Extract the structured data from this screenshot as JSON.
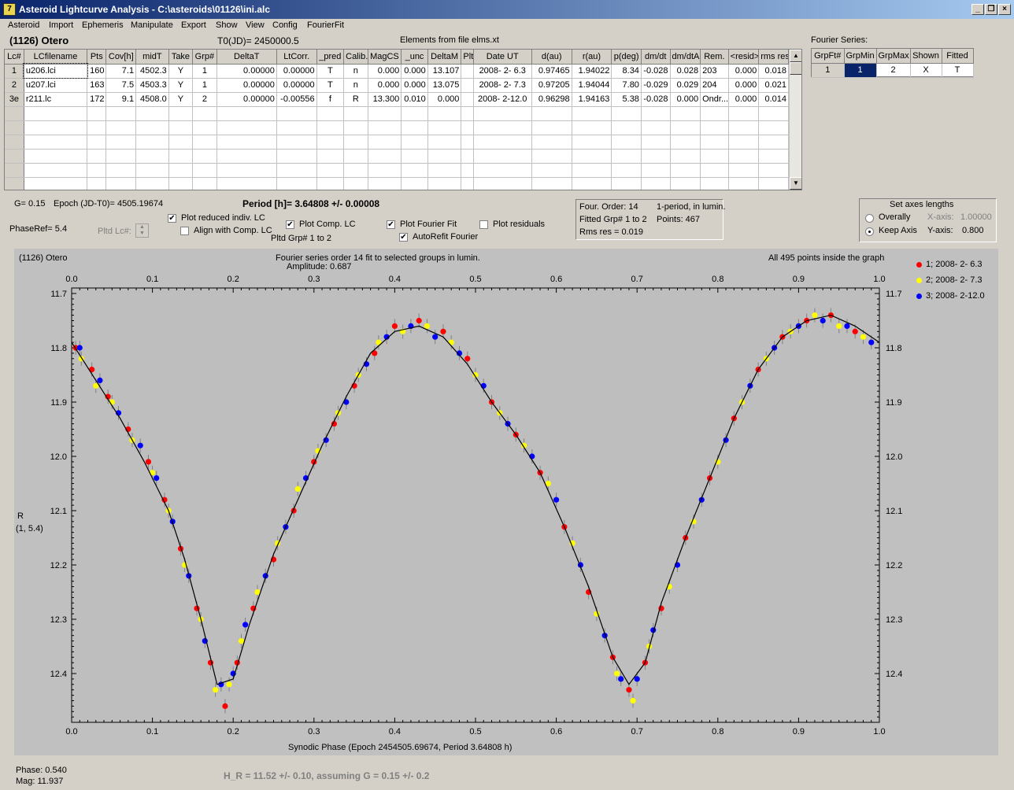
{
  "window": {
    "title": "Asteroid Lightcurve Analysis - C:\\asteroids\\01126\\ini.alc",
    "icon": "app-icon"
  },
  "menu": [
    "Asteroid",
    "Import",
    "Ephemeris",
    "Manipulate",
    "Export",
    "Show",
    "View",
    "Config",
    "FourierFit"
  ],
  "header": {
    "asteroid": "(1126) Otero",
    "t0": "T0(JD)= 2450000.5",
    "elements": "Elements from file elms.xt",
    "fourier_series_label": "Fourier Series:"
  },
  "lc_table": {
    "columns": [
      "Lc#",
      "LCfilename",
      "Pts",
      "Cov[h]",
      "midT",
      "Take",
      "Grp#",
      "DeltaT",
      "LtCorr.",
      "_pred",
      "Calib.",
      "MagCS",
      "_unc",
      "DeltaM",
      "Plt",
      "Date UT",
      "d(au)",
      "r(au)",
      "p(deg)",
      "dm/dt",
      "dm/dtA",
      "Rem.",
      "<resid>",
      "rms res"
    ],
    "rows": [
      [
        "1",
        "u206.lci",
        "160",
        "7.1",
        "4502.3",
        "Y",
        "1",
        "0.00000",
        "0.00000",
        "T",
        "n",
        "0.000",
        "0.000",
        "13.107",
        "",
        "2008- 2- 6.3",
        "0.97465",
        "1.94022",
        "8.34",
        "-0.028",
        "0.028",
        "203",
        "0.000",
        "0.018"
      ],
      [
        "2",
        "u207.lci",
        "163",
        "7.5",
        "4503.3",
        "Y",
        "1",
        "0.00000",
        "0.00000",
        "T",
        "n",
        "0.000",
        "0.000",
        "13.075",
        "",
        "2008- 2- 7.3",
        "0.97205",
        "1.94044",
        "7.80",
        "-0.029",
        "0.029",
        "204",
        "0.000",
        "0.021"
      ],
      [
        "3e",
        "r211.lc",
        "172",
        "9.1",
        "4508.0",
        "Y",
        "2",
        "0.00000",
        "-0.00556",
        "f",
        "R",
        "13.300",
        "0.010",
        "0.000",
        "",
        "2008- 2-12.0",
        "0.96298",
        "1.94163",
        "5.38",
        "-0.028",
        "0.000",
        "Ondr...",
        "0.000",
        "0.014"
      ]
    ],
    "empty_rows": 6
  },
  "fourier_table": {
    "columns": [
      "GrpFt#",
      "GrpMin",
      "GrpMax",
      "Shown",
      "Fitted"
    ],
    "row": [
      "1",
      "1",
      "2",
      "X",
      "T"
    ]
  },
  "controls": {
    "g_line": "G= 0.15",
    "epoch": "Epoch (JD-T0)= 4505.19674",
    "period": "Period [h]= 3.64808 +/- 0.00008",
    "phaseref": "PhaseRef= 5.4",
    "pltd_lc": "Pltd Lc#:",
    "plot_reduced": "Plot reduced indiv. LC",
    "align_comp": "Align with Comp. LC",
    "plot_comp": "Plot Comp. LC",
    "pltd_grp": "Pltd Grp#  1   to   2",
    "plot_fourier": "Plot Fourier Fit",
    "autorefit": "AutoRefit Fourier",
    "plot_residuals": "Plot residuals",
    "checks": {
      "plot_reduced": true,
      "align_comp": false,
      "plot_comp": true,
      "plot_fourier": true,
      "autorefit": true,
      "plot_residuals": false
    }
  },
  "fit_info": {
    "order": "Four. Order: 14",
    "period_mode": "1-period, in lumin.",
    "fitted": "Fitted Grp# 1 to 2",
    "points": "Points: 467",
    "rms": "Rms res     = 0.019"
  },
  "axes_box": {
    "title": "Set axes lengths",
    "overally": "Overally",
    "keep": "Keep Axis",
    "xaxis_label": "X-axis:",
    "xaxis_val": "1.00000",
    "yaxis_label": "Y-axis:",
    "yaxis_val": "0.800",
    "selected": "Keep Axis"
  },
  "plot": {
    "top_left": "(1126) Otero",
    "top_center": "Fourier series order 14 fit to selected groups in lumin.",
    "amplitude": "Amplitude: 0.687",
    "top_right": "All 495 points inside the graph",
    "ylabel1": "R",
    "ylabel2": "(1, 5.4)",
    "xlabel": "Synodic Phase (Epoch 2454505.69674, Period 3.64808 h)",
    "background": "#c0c0c0"
  },
  "chart_data": {
    "type": "scatter",
    "xlabel": "Synodic Phase (Epoch 2454505.69674, Period 3.64808 h)",
    "ylabel": "R",
    "xlim": [
      0,
      1
    ],
    "ylim": [
      11.69,
      12.49
    ],
    "y_inverted": true,
    "x_ticks": [
      "0.0",
      "0.1",
      "0.2",
      "0.3",
      "0.4",
      "0.5",
      "0.6",
      "0.7",
      "0.8",
      "0.9",
      "1.0"
    ],
    "y_ticks": [
      "11.7",
      "11.8",
      "11.9",
      "12.0",
      "12.1",
      "12.2",
      "12.3",
      "12.4"
    ],
    "legend_position": "top-right",
    "series": [
      {
        "name": "1; 2008- 2- 6.3",
        "color": "#ff0000"
      },
      {
        "name": "2; 2008- 2- 7.3",
        "color": "#ffff00"
      },
      {
        "name": "3; 2008- 2-12.0",
        "color": "#0000ff"
      }
    ],
    "fit_curve": [
      [
        0.0,
        11.79
      ],
      [
        0.03,
        11.86
      ],
      [
        0.06,
        11.93
      ],
      [
        0.09,
        12.01
      ],
      [
        0.12,
        12.1
      ],
      [
        0.14,
        12.19
      ],
      [
        0.16,
        12.3
      ],
      [
        0.18,
        12.42
      ],
      [
        0.2,
        12.41
      ],
      [
        0.22,
        12.31
      ],
      [
        0.25,
        12.18
      ],
      [
        0.28,
        12.08
      ],
      [
        0.31,
        11.98
      ],
      [
        0.34,
        11.89
      ],
      [
        0.37,
        11.81
      ],
      [
        0.4,
        11.77
      ],
      [
        0.43,
        11.76
      ],
      [
        0.46,
        11.78
      ],
      [
        0.49,
        11.83
      ],
      [
        0.52,
        11.9
      ],
      [
        0.55,
        11.96
      ],
      [
        0.58,
        12.03
      ],
      [
        0.61,
        12.13
      ],
      [
        0.64,
        12.24
      ],
      [
        0.67,
        12.37
      ],
      [
        0.69,
        12.42
      ],
      [
        0.71,
        12.38
      ],
      [
        0.73,
        12.27
      ],
      [
        0.76,
        12.15
      ],
      [
        0.79,
        12.04
      ],
      [
        0.82,
        11.93
      ],
      [
        0.85,
        11.84
      ],
      [
        0.88,
        11.78
      ],
      [
        0.91,
        11.75
      ],
      [
        0.94,
        11.74
      ],
      [
        0.97,
        11.76
      ],
      [
        1.0,
        11.79
      ]
    ],
    "points": [
      {
        "s": 0,
        "x": 0.005,
        "y": 11.8
      },
      {
        "s": 1,
        "x": 0.012,
        "y": 11.82
      },
      {
        "s": 2,
        "x": 0.01,
        "y": 11.8
      },
      {
        "s": 0,
        "x": 0.025,
        "y": 11.84
      },
      {
        "s": 1,
        "x": 0.03,
        "y": 11.87
      },
      {
        "s": 2,
        "x": 0.035,
        "y": 11.86
      },
      {
        "s": 0,
        "x": 0.045,
        "y": 11.89
      },
      {
        "s": 1,
        "x": 0.05,
        "y": 11.9
      },
      {
        "s": 2,
        "x": 0.058,
        "y": 11.92
      },
      {
        "s": 0,
        "x": 0.07,
        "y": 11.95
      },
      {
        "s": 1,
        "x": 0.075,
        "y": 11.97
      },
      {
        "s": 2,
        "x": 0.085,
        "y": 11.98
      },
      {
        "s": 0,
        "x": 0.095,
        "y": 12.01
      },
      {
        "s": 1,
        "x": 0.1,
        "y": 12.03
      },
      {
        "s": 2,
        "x": 0.105,
        "y": 12.04
      },
      {
        "s": 0,
        "x": 0.115,
        "y": 12.08
      },
      {
        "s": 1,
        "x": 0.12,
        "y": 12.1
      },
      {
        "s": 2,
        "x": 0.125,
        "y": 12.12
      },
      {
        "s": 0,
        "x": 0.135,
        "y": 12.17
      },
      {
        "s": 1,
        "x": 0.14,
        "y": 12.2
      },
      {
        "s": 2,
        "x": 0.145,
        "y": 12.22
      },
      {
        "s": 0,
        "x": 0.155,
        "y": 12.28
      },
      {
        "s": 1,
        "x": 0.16,
        "y": 12.3
      },
      {
        "s": 2,
        "x": 0.165,
        "y": 12.34
      },
      {
        "s": 0,
        "x": 0.172,
        "y": 12.38
      },
      {
        "s": 1,
        "x": 0.178,
        "y": 12.43
      },
      {
        "s": 2,
        "x": 0.185,
        "y": 12.42
      },
      {
        "s": 0,
        "x": 0.19,
        "y": 12.46
      },
      {
        "s": 1,
        "x": 0.195,
        "y": 12.42
      },
      {
        "s": 2,
        "x": 0.2,
        "y": 12.4
      },
      {
        "s": 0,
        "x": 0.205,
        "y": 12.38
      },
      {
        "s": 1,
        "x": 0.21,
        "y": 12.34
      },
      {
        "s": 2,
        "x": 0.215,
        "y": 12.31
      },
      {
        "s": 0,
        "x": 0.225,
        "y": 12.28
      },
      {
        "s": 1,
        "x": 0.23,
        "y": 12.25
      },
      {
        "s": 2,
        "x": 0.24,
        "y": 12.22
      },
      {
        "s": 0,
        "x": 0.25,
        "y": 12.19
      },
      {
        "s": 1,
        "x": 0.255,
        "y": 12.16
      },
      {
        "s": 2,
        "x": 0.265,
        "y": 12.13
      },
      {
        "s": 0,
        "x": 0.275,
        "y": 12.1
      },
      {
        "s": 1,
        "x": 0.28,
        "y": 12.06
      },
      {
        "s": 2,
        "x": 0.29,
        "y": 12.04
      },
      {
        "s": 0,
        "x": 0.3,
        "y": 12.01
      },
      {
        "s": 1,
        "x": 0.305,
        "y": 11.99
      },
      {
        "s": 2,
        "x": 0.315,
        "y": 11.97
      },
      {
        "s": 0,
        "x": 0.325,
        "y": 11.94
      },
      {
        "s": 1,
        "x": 0.33,
        "y": 11.92
      },
      {
        "s": 2,
        "x": 0.34,
        "y": 11.9
      },
      {
        "s": 0,
        "x": 0.35,
        "y": 11.87
      },
      {
        "s": 1,
        "x": 0.355,
        "y": 11.85
      },
      {
        "s": 2,
        "x": 0.365,
        "y": 11.83
      },
      {
        "s": 0,
        "x": 0.375,
        "y": 11.81
      },
      {
        "s": 1,
        "x": 0.38,
        "y": 11.79
      },
      {
        "s": 2,
        "x": 0.39,
        "y": 11.78
      },
      {
        "s": 0,
        "x": 0.4,
        "y": 11.76
      },
      {
        "s": 1,
        "x": 0.41,
        "y": 11.77
      },
      {
        "s": 2,
        "x": 0.42,
        "y": 11.76
      },
      {
        "s": 0,
        "x": 0.43,
        "y": 11.75
      },
      {
        "s": 1,
        "x": 0.44,
        "y": 11.76
      },
      {
        "s": 2,
        "x": 0.45,
        "y": 11.78
      },
      {
        "s": 0,
        "x": 0.46,
        "y": 11.77
      },
      {
        "s": 1,
        "x": 0.47,
        "y": 11.79
      },
      {
        "s": 2,
        "x": 0.48,
        "y": 11.81
      },
      {
        "s": 0,
        "x": 0.49,
        "y": 11.82
      },
      {
        "s": 1,
        "x": 0.5,
        "y": 11.85
      },
      {
        "s": 2,
        "x": 0.51,
        "y": 11.87
      },
      {
        "s": 0,
        "x": 0.52,
        "y": 11.9
      },
      {
        "s": 1,
        "x": 0.53,
        "y": 11.92
      },
      {
        "s": 2,
        "x": 0.54,
        "y": 11.94
      },
      {
        "s": 0,
        "x": 0.55,
        "y": 11.96
      },
      {
        "s": 1,
        "x": 0.56,
        "y": 11.98
      },
      {
        "s": 2,
        "x": 0.57,
        "y": 12.0
      },
      {
        "s": 0,
        "x": 0.58,
        "y": 12.03
      },
      {
        "s": 1,
        "x": 0.59,
        "y": 12.05
      },
      {
        "s": 2,
        "x": 0.6,
        "y": 12.08
      },
      {
        "s": 0,
        "x": 0.61,
        "y": 12.13
      },
      {
        "s": 1,
        "x": 0.62,
        "y": 12.16
      },
      {
        "s": 2,
        "x": 0.63,
        "y": 12.2
      },
      {
        "s": 0,
        "x": 0.64,
        "y": 12.25
      },
      {
        "s": 1,
        "x": 0.65,
        "y": 12.29
      },
      {
        "s": 2,
        "x": 0.66,
        "y": 12.33
      },
      {
        "s": 0,
        "x": 0.67,
        "y": 12.37
      },
      {
        "s": 1,
        "x": 0.675,
        "y": 12.4
      },
      {
        "s": 2,
        "x": 0.68,
        "y": 12.41
      },
      {
        "s": 0,
        "x": 0.69,
        "y": 12.43
      },
      {
        "s": 1,
        "x": 0.695,
        "y": 12.45
      },
      {
        "s": 2,
        "x": 0.7,
        "y": 12.41
      },
      {
        "s": 0,
        "x": 0.71,
        "y": 12.38
      },
      {
        "s": 1,
        "x": 0.715,
        "y": 12.35
      },
      {
        "s": 2,
        "x": 0.72,
        "y": 12.32
      },
      {
        "s": 0,
        "x": 0.73,
        "y": 12.28
      },
      {
        "s": 1,
        "x": 0.74,
        "y": 12.24
      },
      {
        "s": 2,
        "x": 0.75,
        "y": 12.2
      },
      {
        "s": 0,
        "x": 0.76,
        "y": 12.15
      },
      {
        "s": 1,
        "x": 0.77,
        "y": 12.12
      },
      {
        "s": 2,
        "x": 0.78,
        "y": 12.08
      },
      {
        "s": 0,
        "x": 0.79,
        "y": 12.04
      },
      {
        "s": 1,
        "x": 0.8,
        "y": 12.01
      },
      {
        "s": 2,
        "x": 0.81,
        "y": 11.97
      },
      {
        "s": 0,
        "x": 0.82,
        "y": 11.93
      },
      {
        "s": 1,
        "x": 0.83,
        "y": 11.9
      },
      {
        "s": 2,
        "x": 0.84,
        "y": 11.87
      },
      {
        "s": 0,
        "x": 0.85,
        "y": 11.84
      },
      {
        "s": 1,
        "x": 0.86,
        "y": 11.82
      },
      {
        "s": 2,
        "x": 0.87,
        "y": 11.8
      },
      {
        "s": 0,
        "x": 0.88,
        "y": 11.78
      },
      {
        "s": 1,
        "x": 0.89,
        "y": 11.77
      },
      {
        "s": 2,
        "x": 0.9,
        "y": 11.76
      },
      {
        "s": 0,
        "x": 0.91,
        "y": 11.75
      },
      {
        "s": 1,
        "x": 0.92,
        "y": 11.74
      },
      {
        "s": 2,
        "x": 0.93,
        "y": 11.75
      },
      {
        "s": 0,
        "x": 0.94,
        "y": 11.74
      },
      {
        "s": 1,
        "x": 0.95,
        "y": 11.76
      },
      {
        "s": 2,
        "x": 0.96,
        "y": 11.76
      },
      {
        "s": 0,
        "x": 0.97,
        "y": 11.77
      },
      {
        "s": 1,
        "x": 0.98,
        "y": 11.78
      },
      {
        "s": 2,
        "x": 0.99,
        "y": 11.79
      }
    ]
  },
  "status": {
    "phase": "Phase:  0.540",
    "mag": "Mag:    11.937",
    "hr": "H_R = 11.52 +/- 0.10, assuming G = 0.15 +/- 0.2"
  }
}
